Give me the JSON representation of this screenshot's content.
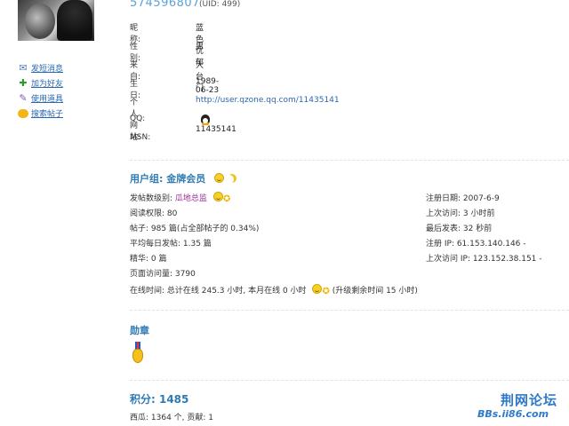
{
  "header": {
    "username_big": "574596807",
    "uid": "(UID: 499)"
  },
  "sidebar": {
    "actions": [
      {
        "label": "发短消息",
        "icon": "mail-icon"
      },
      {
        "label": "加为好友",
        "icon": "add-friend-icon"
      },
      {
        "label": "使用道具",
        "icon": "magic-wand-icon"
      },
      {
        "label": "搜索帖子",
        "icon": "chat-bubble-icon"
      }
    ]
  },
  "profile": {
    "nickname_label": "昵称:",
    "nickname": "蓝色忧郁",
    "gender_label": "性别:",
    "gender": "男",
    "from_label": "来自:",
    "from": "大台门",
    "birthday_label": "生日:",
    "birthday": "1989-06-23",
    "website_label": "个人网站:",
    "website": "http://user.qzone.qq.com/11435141",
    "qq_label": "QQ:",
    "qq": "11435141",
    "msn_label": "MSN:",
    "msn": ""
  },
  "group": {
    "title": "用户组: 金牌会员"
  },
  "stats_left": {
    "post_level_label": "发帖数级别:",
    "post_level": "瓜地总监",
    "read_perm": "阅读权限: 80",
    "posts": "帖子: 985 篇(占全部帖子的 0.34%)",
    "avg_daily": "平均每日发帖: 1.35 篇",
    "digest": "精华: 0 篇",
    "page_views": "页面访问量: 3790"
  },
  "stats_right": {
    "reg_date": "注册日期: 2007-6-9",
    "last_visit": "上次访问: 3 小时前",
    "last_post": "最后发表: 32 秒前",
    "reg_ip": "注册 IP: 61.153.140.146 -",
    "last_ip": "上次访问 IP: 123.152.38.151 -"
  },
  "online": {
    "text_a": "在线时间: 总计在线 245.3 小时, 本月在线 0 小时",
    "text_b": "(升级剩余时间 15 小时)"
  },
  "medals": {
    "title": "勋章"
  },
  "credits": {
    "score": "积分: 1485",
    "detail": "西瓜: 1364 个, 贡献: 1"
  },
  "watermark": {
    "title": "荆网论坛",
    "url": "BBs.ii86.com"
  },
  "colors": {
    "accent": "#2e7bb4",
    "link": "#2a67b1",
    "uid_big": "#5aa3d8",
    "level": "#9b2d9b"
  }
}
